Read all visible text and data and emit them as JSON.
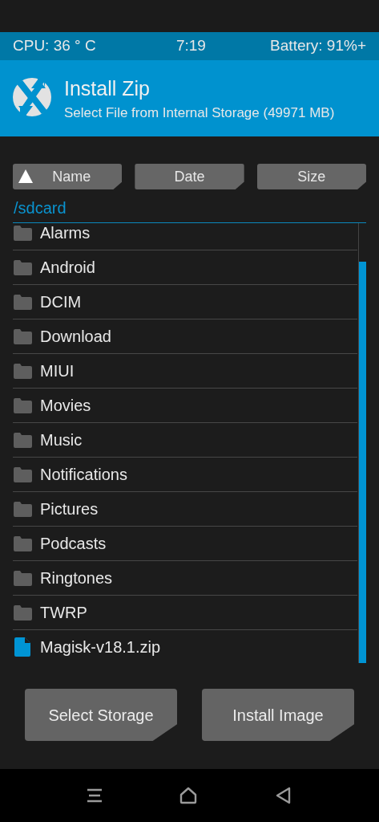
{
  "status_bar": {
    "cpu": "CPU: 36 ° C",
    "time": "7:19",
    "battery": "Battery: 91%+"
  },
  "header": {
    "title": "Install Zip",
    "subtitle": "Select File from Internal Storage (49971 MB)"
  },
  "sort_buttons": [
    {
      "label": "Name",
      "selected": true
    },
    {
      "label": "Date",
      "selected": false
    },
    {
      "label": "Size",
      "selected": false
    }
  ],
  "path": "/sdcard",
  "files": [
    {
      "name": "Alarms",
      "kind": "folder"
    },
    {
      "name": "Android",
      "kind": "folder"
    },
    {
      "name": "DCIM",
      "kind": "folder"
    },
    {
      "name": "Download",
      "kind": "folder"
    },
    {
      "name": "MIUI",
      "kind": "folder"
    },
    {
      "name": "Movies",
      "kind": "folder"
    },
    {
      "name": "Music",
      "kind": "folder"
    },
    {
      "name": "Notifications",
      "kind": "folder"
    },
    {
      "name": "Pictures",
      "kind": "folder"
    },
    {
      "name": "Podcasts",
      "kind": "folder"
    },
    {
      "name": "Ringtones",
      "kind": "folder"
    },
    {
      "name": "TWRP",
      "kind": "folder"
    },
    {
      "name": "Magisk-v18.1.zip",
      "kind": "file"
    }
  ],
  "actions": [
    "Select Storage",
    "Install Image"
  ]
}
